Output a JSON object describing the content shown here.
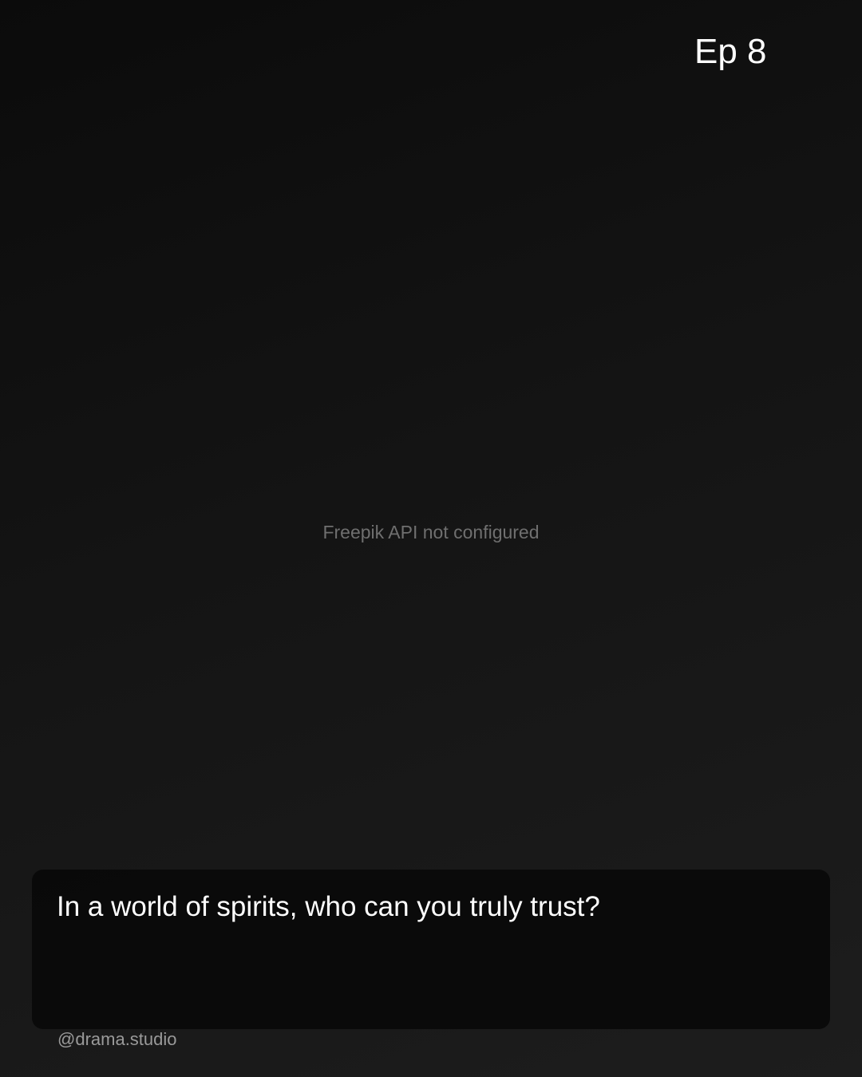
{
  "episode": {
    "label": "Ep 8"
  },
  "image_placeholder": {
    "message": "Freepik API not configured"
  },
  "caption": {
    "text": "In a world of spirits, who can you truly trust?"
  },
  "footer": {
    "handle": "@drama.studio"
  },
  "colors": {
    "background_dark": "#0b0b0b",
    "background_light": "#1d1d1d",
    "caption_box": "#0a0a0a",
    "text_primary": "#ffffff",
    "text_muted": "#6f6f6f",
    "handle_text": "#9a9a9a"
  }
}
